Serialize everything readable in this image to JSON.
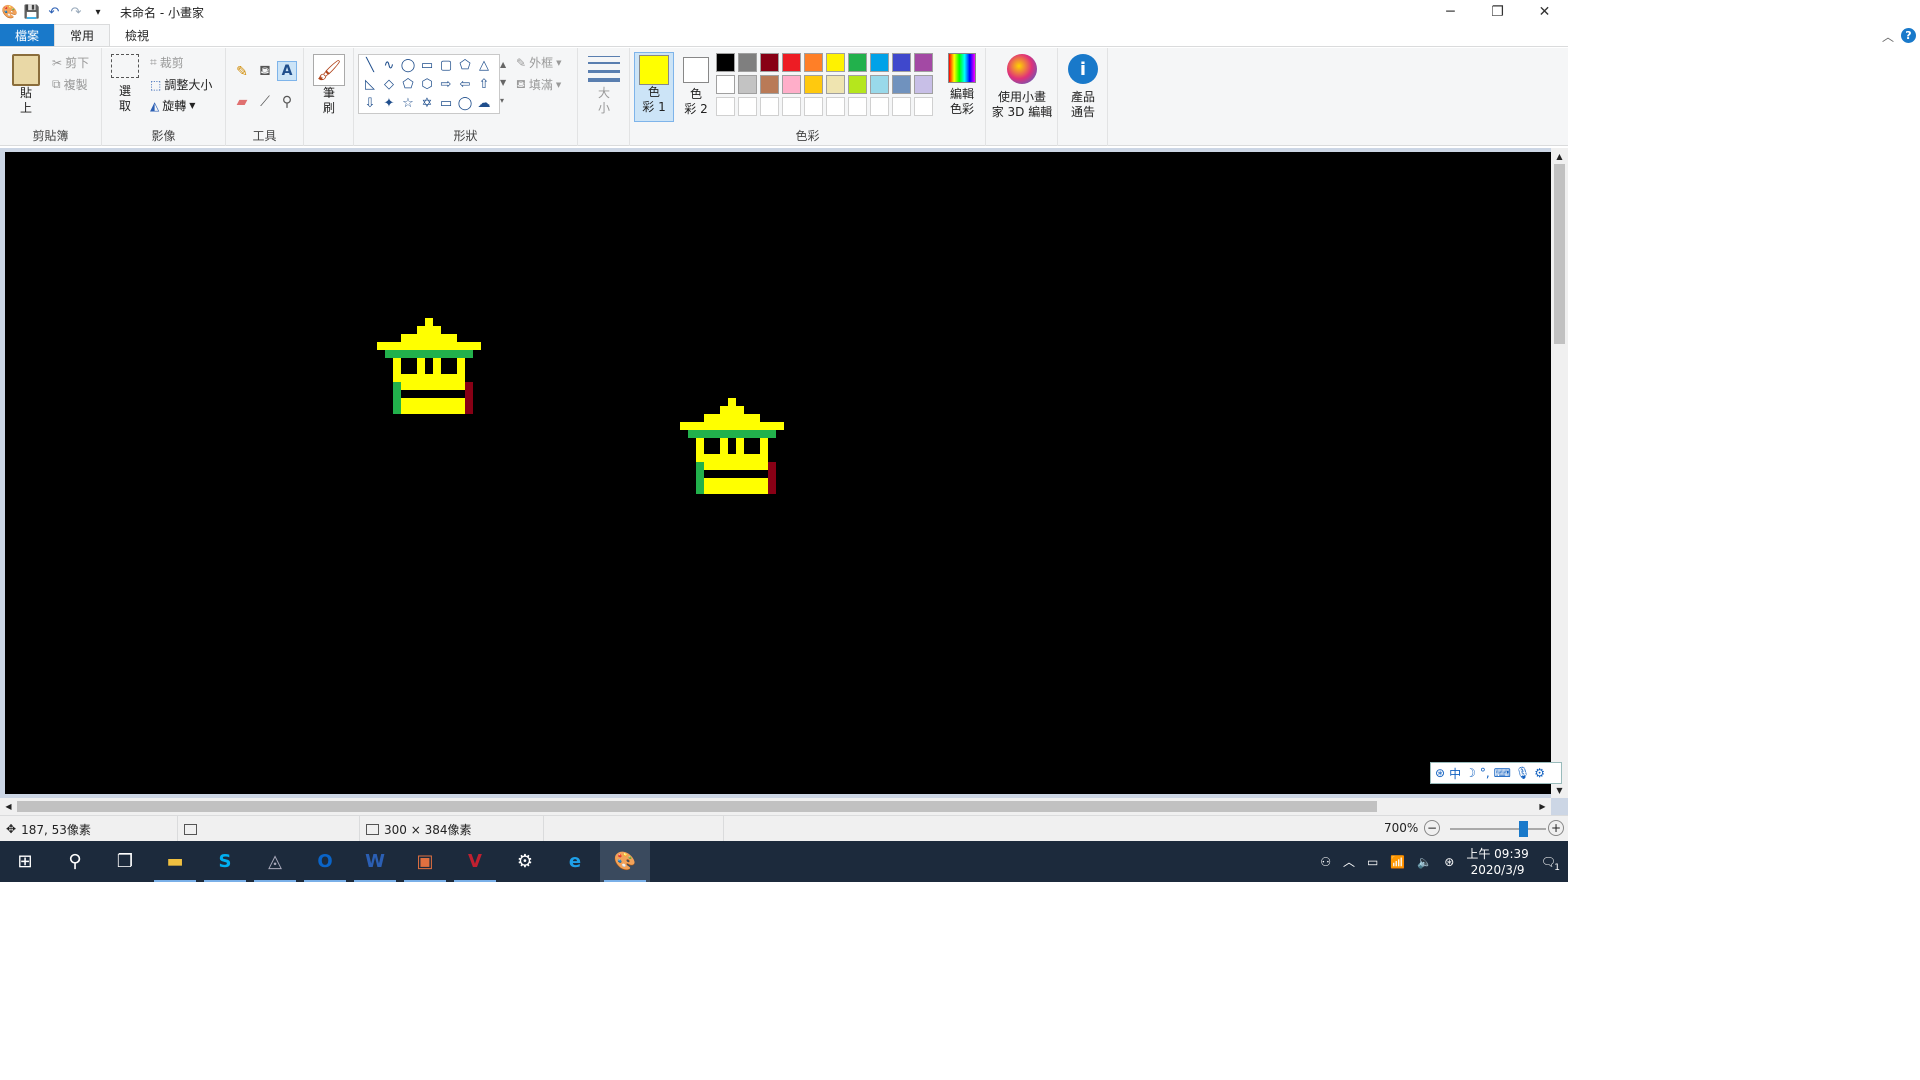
{
  "window": {
    "title": "未命名 - 小畫家",
    "controls": {
      "minimize": "─",
      "restore": "❐",
      "close": "✕"
    }
  },
  "quick_access": {
    "customize_icon": "▾"
  },
  "tabs": [
    {
      "label": "檔案"
    },
    {
      "label": "常用"
    },
    {
      "label": "檢視"
    }
  ],
  "help_label": "?",
  "ribbon": {
    "clipboard": {
      "paste_label": "貼\n上",
      "cut_label": "剪下",
      "copy_label": "複製",
      "group_label": "剪貼簿"
    },
    "image": {
      "select_label": "選\n取",
      "crop_label": "裁剪",
      "resize_label": "調整大小",
      "rotate_label": "旋轉",
      "group_label": "影像"
    },
    "tools": {
      "group_label": "工具"
    },
    "brushes": {
      "label": "筆\n刷"
    },
    "shapes": {
      "outline_label": "外框",
      "fill_label": "填滿",
      "group_label": "形狀"
    },
    "size": {
      "label": "大\n小"
    },
    "colors": {
      "color1_label": "色\n彩 1",
      "color2_label": "色\n彩 2",
      "edit_colors_label": "編輯\n色彩",
      "group_label": "色彩",
      "color1": "#ffff00",
      "color2": "#ffffff",
      "palette_row1": [
        "#000000",
        "#7f7f7f",
        "#880015",
        "#ed1c24",
        "#ff7f27",
        "#fff200",
        "#22b14c",
        "#00a2e8",
        "#3f48cc",
        "#a349a4"
      ],
      "palette_row2": [
        "#ffffff",
        "#c3c3c3",
        "#b97a57",
        "#ffaec9",
        "#ffc90e",
        "#efe4b0",
        "#b5e61d",
        "#99d9ea",
        "#7092be",
        "#c8bfe7"
      ]
    },
    "paint3d_label": "使用小畫\n家 3D 編輯",
    "notice_label": "產品\n通告"
  },
  "status": {
    "cursor_pos": "187, 53像素",
    "image_size": "300 × 384像素",
    "zoom": "700%",
    "zoom_fraction": 0.7
  },
  "taskbar": {
    "clock_time": "上午 09:39",
    "clock_date": "2020/3/9",
    "notification_count": "1"
  },
  "ime": {
    "mode": "中"
  }
}
